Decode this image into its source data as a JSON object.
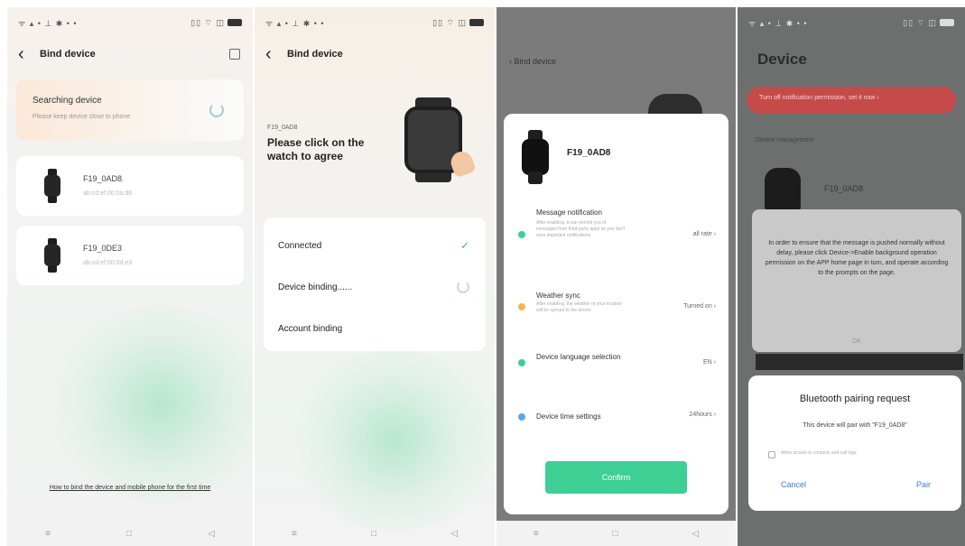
{
  "screen1": {
    "status_left": "ᯤ ▴ • ⊥ ✱ • •",
    "status_right": "▯▯ ⌔ ◫",
    "header_title": "Bind device",
    "search_title": "Searching device",
    "search_hint": "Please keep device close to phone",
    "devices": [
      {
        "name": "F19_0AD8",
        "sub": "ab:cd:ef:00:0a:d8"
      },
      {
        "name": "F19_0DE3",
        "sub": "ab:cd:ef:00:0d:e3"
      }
    ],
    "help_link": "How to bind the device and mobile phone for the first time",
    "nav": [
      "≡",
      "□",
      "◁"
    ]
  },
  "screen2": {
    "header_title": "Bind device",
    "model": "F19_0AD8",
    "prompt": "Please click on the watch to agree",
    "steps": [
      {
        "label": "Connected",
        "state": "done"
      },
      {
        "label": "Device binding......",
        "state": "loading"
      },
      {
        "label": "Account binding",
        "state": "pending"
      }
    ],
    "nav": [
      "≡",
      "□",
      "◁"
    ]
  },
  "screen3": {
    "header_title": "Bind device",
    "device_name": "F19_0AD8",
    "settings": [
      {
        "label": "Message notification",
        "desc": "After enabling, it can remind you of messages from third-party apps so you don't miss important notifications",
        "value": "all  rate ›",
        "color": "#3dcf94"
      },
      {
        "label": "Weather sync",
        "desc": "After enabling, the weather of your location will be synced to the device",
        "value": "Turned on ›",
        "color": "#f2b54a"
      },
      {
        "label": "Device language selection",
        "desc": "",
        "value": "EN  ›",
        "color": "#3dcf94"
      },
      {
        "label": "Device time settings",
        "desc": "",
        "value": "24hours ›",
        "color": "#5aa7e8"
      }
    ],
    "confirm_label": "Confirm",
    "nav": [
      "≡",
      "□",
      "◁"
    ]
  },
  "screen4": {
    "title": "Device",
    "banner": "Turn off notification permission, set it now ›",
    "section": "Device management",
    "device_name": "F19_0AD8",
    "info_text": "In order to ensure that the message is pushed normally without delay, please click Device->Enable background operation permission on the APP home page in turn, and operate according to the prompts on the page.",
    "info_ok": "OK",
    "bt_title": "Bluetooth pairing request",
    "bt_sub": "This device will pair with \"F19_0AD8\"",
    "bt_checkbox": "Allow access to contacts and call logs",
    "bt_cancel": "Cancel",
    "bt_pair": "Pair"
  },
  "colors": {
    "accent_green": "#3dcf94",
    "link_blue": "#3a7fd4",
    "banner_red": "#c54a4a"
  }
}
